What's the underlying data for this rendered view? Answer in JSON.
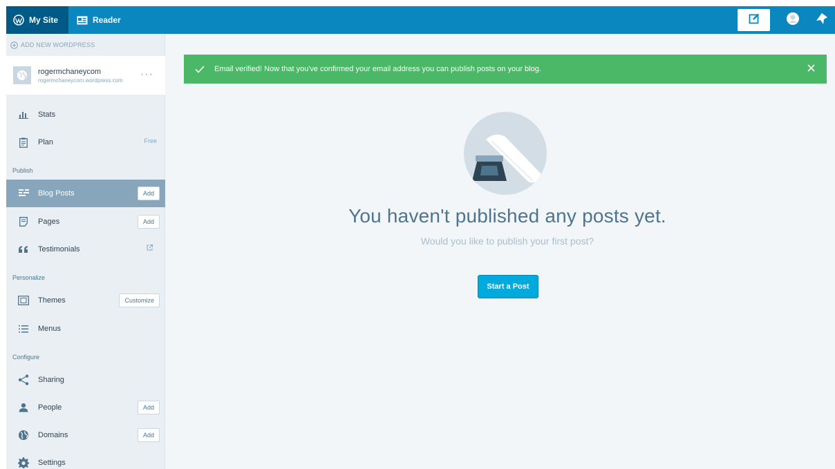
{
  "topbar": {
    "my_site": "My Site",
    "reader": "Reader",
    "icons": {
      "wordpress": "wordpress-logo-icon",
      "reader": "reader-icon",
      "write": "write-post-icon",
      "me": "avatar-icon",
      "notifications": "notifications-icon"
    }
  },
  "sidebar": {
    "add_new": "ADD NEW WORDPRESS",
    "site": {
      "name": "rogermchaneycom",
      "url": "rogermchaneycom.wordpress.com",
      "more": "···"
    },
    "stats": "Stats",
    "plan": "Plan",
    "plan_badge": "Free",
    "section_publish": "Publish",
    "blog_posts": "Blog Posts",
    "pages": "Pages",
    "testimonials": "Testimonials",
    "section_personalize": "Personalize",
    "themes": "Themes",
    "customize": "Customize",
    "menus": "Menus",
    "section_configure": "Configure",
    "sharing": "Sharing",
    "people": "People",
    "domains": "Domains",
    "settings": "Settings",
    "add": "Add"
  },
  "notice": {
    "text": "Email verified! Now that you've confirmed your email address you can publish posts on your blog.",
    "color": "#4ab866"
  },
  "empty": {
    "title": "You haven't published any posts yet.",
    "line": "Would you like to publish your first post?",
    "action": "Start a Post"
  },
  "colors": {
    "masterbar": "#0a87be",
    "masterbar_active": "#005a87",
    "primary_button": "#00aadc",
    "sidebar": "#e9eff3",
    "selected": "#87a6bc"
  }
}
